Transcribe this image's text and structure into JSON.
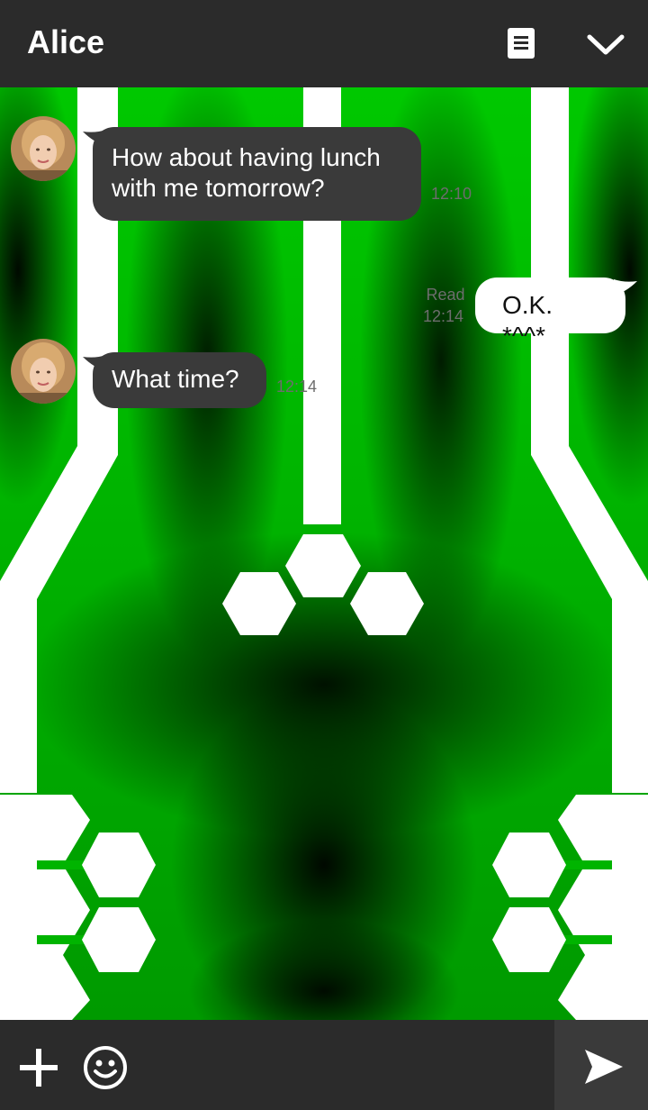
{
  "header": {
    "title": "Alice",
    "memo_icon": "memo-icon",
    "menu_icon": "chevron-down-icon"
  },
  "messages": [
    {
      "from": "Alice",
      "direction": "incoming",
      "lines": [
        "How about having lunch",
        "with me tomorrow?"
      ],
      "time": "12:10"
    },
    {
      "from": "me",
      "direction": "outgoing",
      "lines": [
        "O.K. *^^*"
      ],
      "status": "Read",
      "time": "12:14"
    },
    {
      "from": "Alice",
      "direction": "incoming",
      "lines": [
        "What time?"
      ],
      "time": "12:14"
    }
  ],
  "input_bar": {
    "add_icon": "plus-icon",
    "emoji_icon": "emoji-icon",
    "send_icon": "send-icon"
  },
  "colors": {
    "header_bg": "#2b2b2b",
    "incoming_bubble": "#3a3a3a",
    "outgoing_bubble": "#ffffff",
    "theme_green": "#00b400",
    "send_area": "#3a3a3a"
  }
}
